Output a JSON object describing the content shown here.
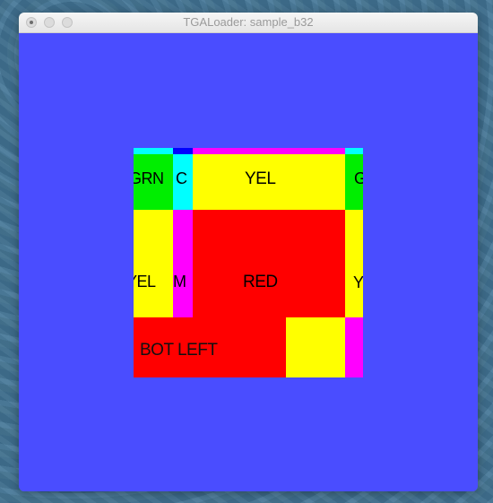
{
  "window": {
    "title": "TGALoader: sample_b32"
  },
  "colors": {
    "canvas_bg": "#4a4dff",
    "red": "#ff0000",
    "yellow": "#ffff00",
    "green": "#00ee00",
    "cyan": "#00ffff",
    "magenta": "#ff00ff",
    "blue": "#0000ff"
  },
  "texture": {
    "labels": {
      "grn": "GRN",
      "c": "C",
      "yel_top": "YEL",
      "g_right": "G",
      "yel_left": "YEL",
      "m": "M",
      "red": "RED",
      "y_right": "Y",
      "bot_left": "BOT LEFT"
    }
  }
}
